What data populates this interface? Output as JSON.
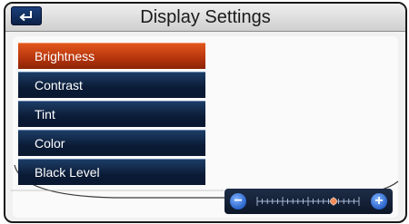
{
  "header": {
    "title": "Display Settings"
  },
  "menu": {
    "items": [
      {
        "label": "Brightness",
        "selected": true
      },
      {
        "label": "Contrast",
        "selected": false
      },
      {
        "label": "Tint",
        "selected": false
      },
      {
        "label": "Color",
        "selected": false
      },
      {
        "label": "Black Level",
        "selected": false
      }
    ]
  },
  "slider": {
    "minus_label": "−",
    "plus_label": "+",
    "level": 0.75
  },
  "colors": {
    "selected_item": "#c2410f",
    "menu_item": "#132c50",
    "accent_button": "#2a63c9"
  },
  "icons": {
    "back": "back-arrow-icon",
    "minus": "minus-icon",
    "plus": "plus-icon"
  }
}
